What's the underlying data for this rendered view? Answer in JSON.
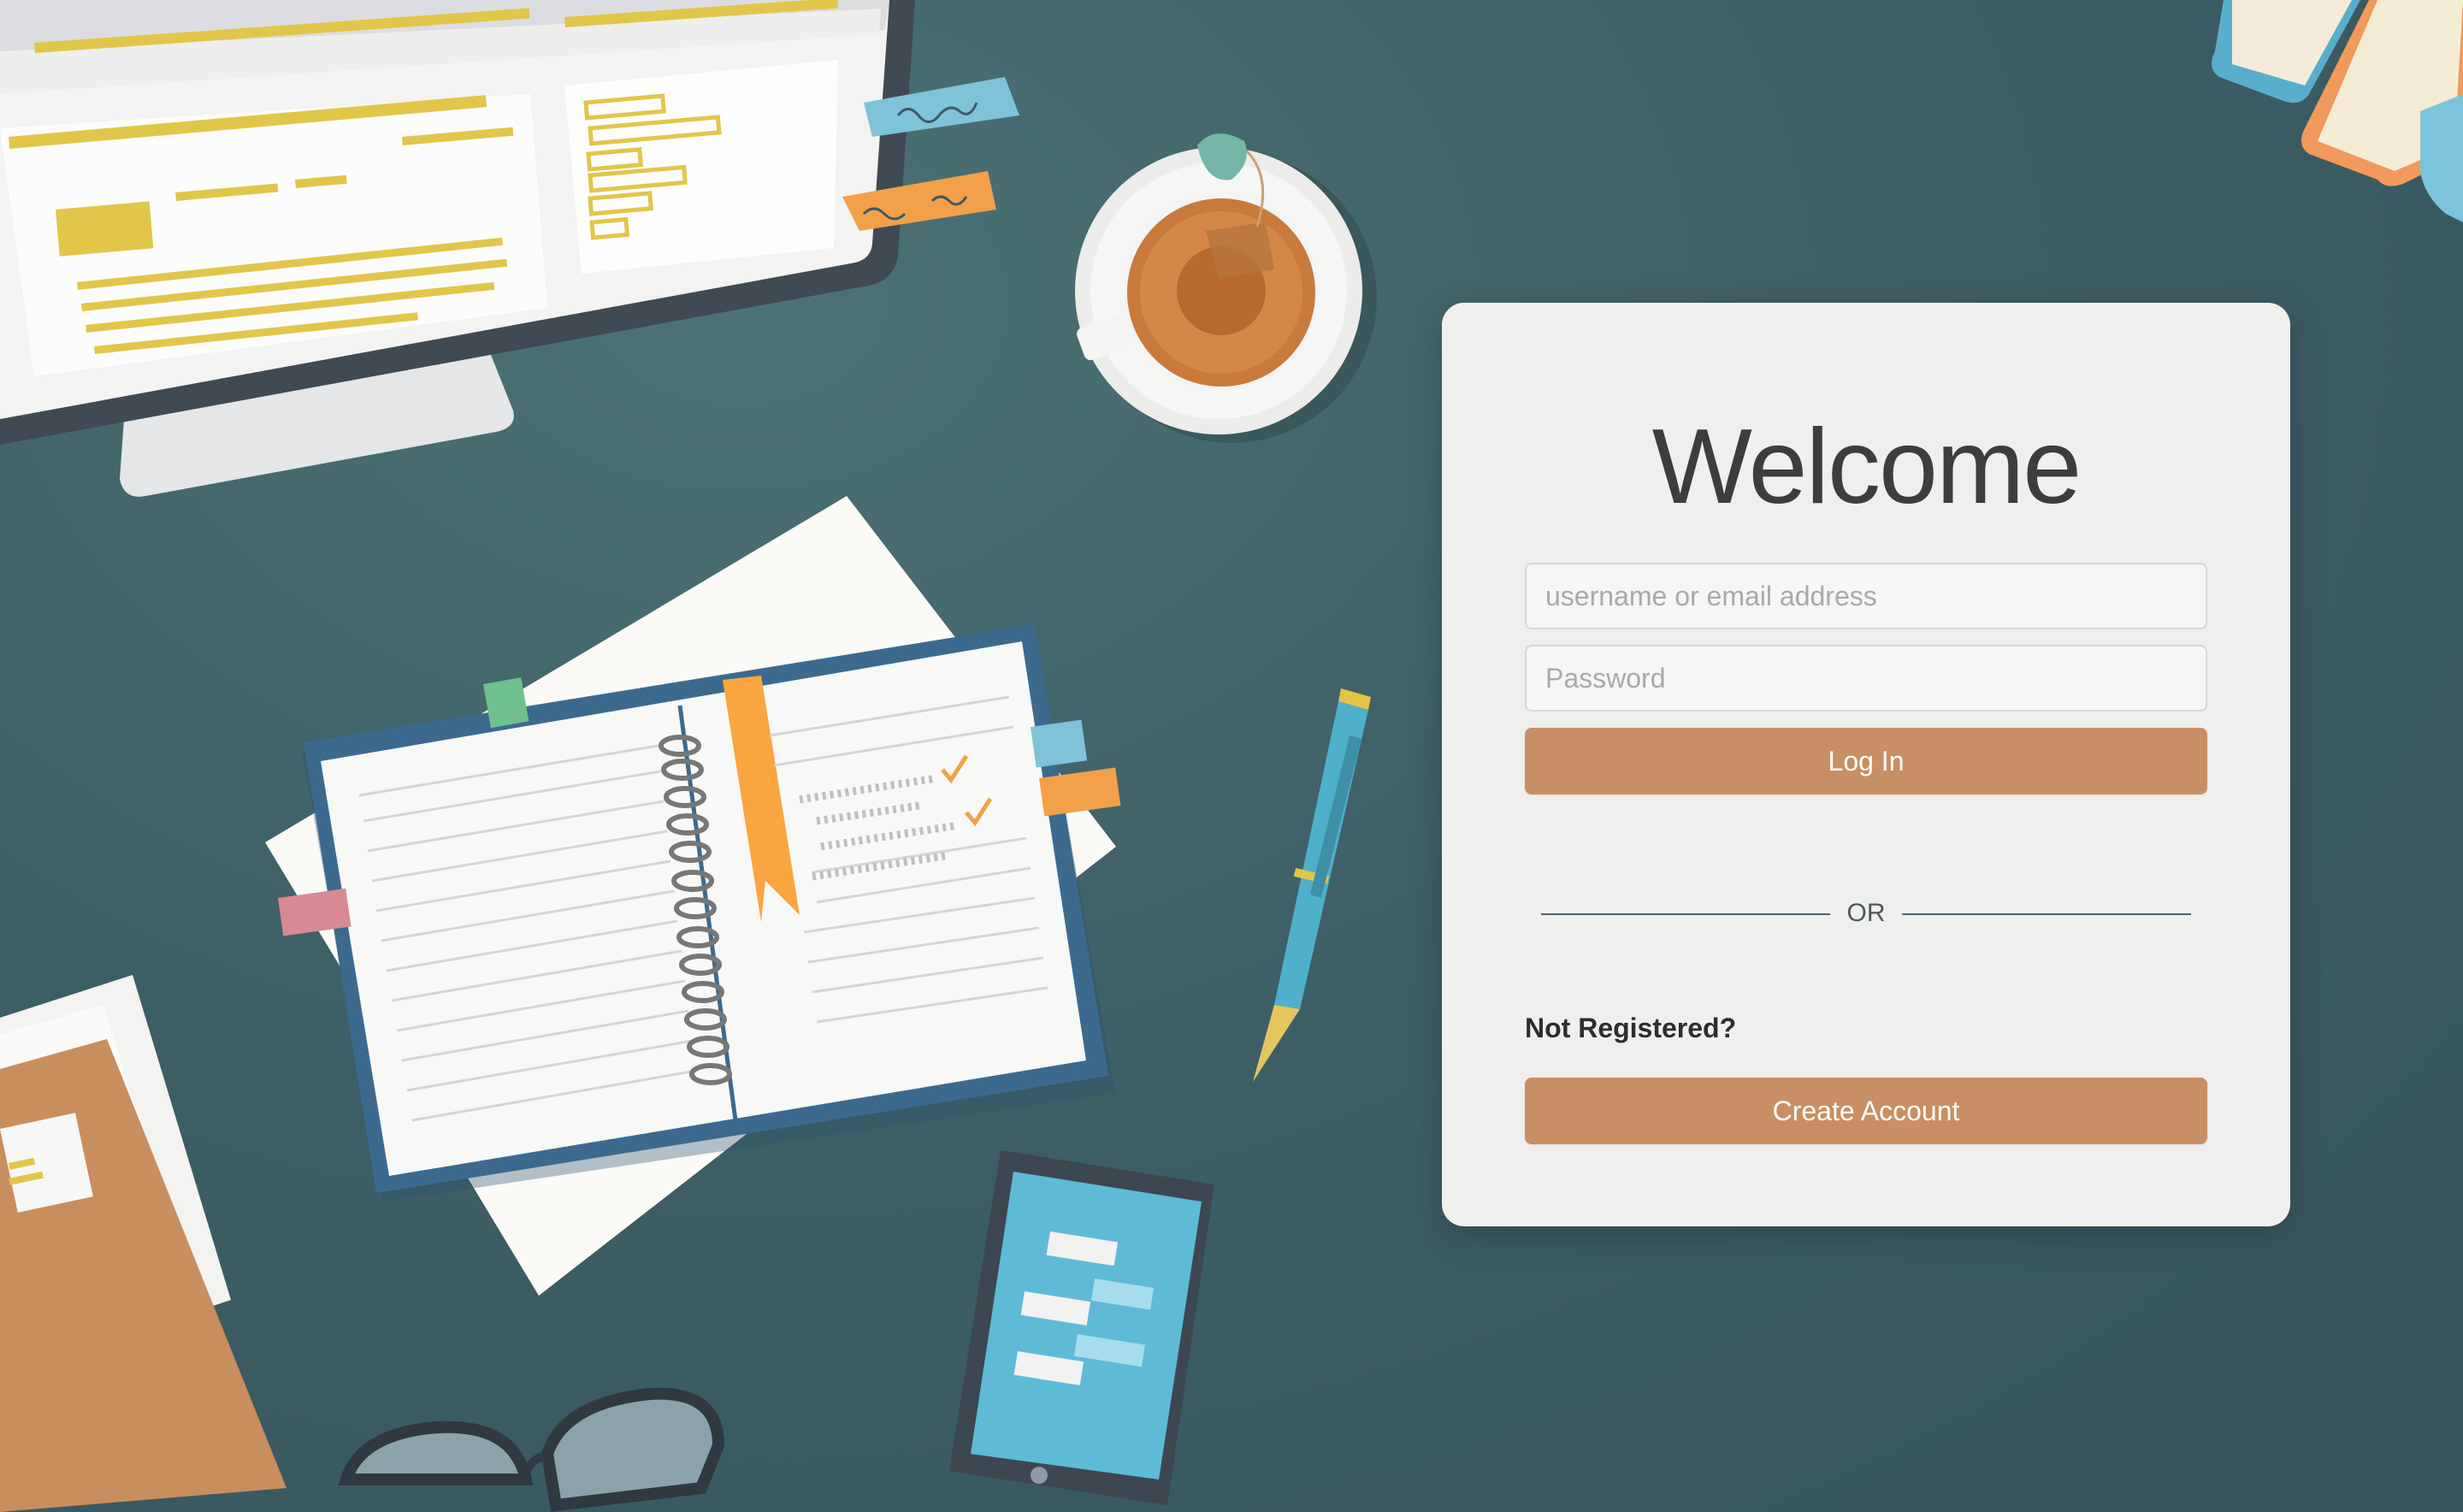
{
  "login": {
    "title": "Welcome",
    "username_placeholder": "username or email address",
    "password_placeholder": "Password",
    "login_label": "Log In",
    "divider_label": "OR",
    "signup_prompt": "Not Registered?",
    "create_account_label": "Create Account"
  },
  "colors": {
    "background": "#3e5f66",
    "card": "#efefed",
    "accent": "#c98f64"
  },
  "illustration": {
    "objects": [
      "monitor",
      "sticky-notes",
      "tea-cup",
      "notebook",
      "pen",
      "smartphone",
      "folder",
      "glasses",
      "books"
    ]
  }
}
